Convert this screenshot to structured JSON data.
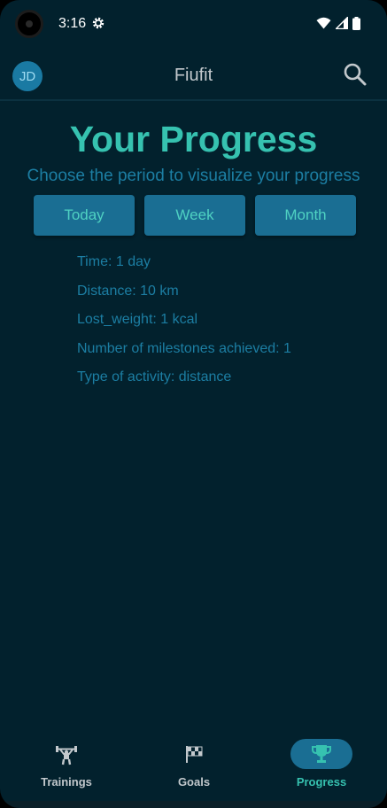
{
  "status_bar": {
    "time": "3:16"
  },
  "app_bar": {
    "avatar_initials": "JD",
    "title": "Fiufit"
  },
  "main": {
    "heading": "Your Progress",
    "subheading": "Choose the period to visualize your progress",
    "period_buttons": [
      "Today",
      "Week",
      "Month"
    ],
    "stats": [
      "Time: 1 day",
      "Distance: 10 km",
      "Lost_weight: 1 kcal",
      "Number of milestones achieved: 1",
      "Type of activity: distance"
    ]
  },
  "bottom_nav": {
    "items": [
      {
        "label": "Trainings",
        "icon": "weightlifter-icon"
      },
      {
        "label": "Goals",
        "icon": "checkered-flag-icon"
      },
      {
        "label": "Progress",
        "icon": "trophy-icon",
        "active": true
      }
    ]
  },
  "colors": {
    "background": "#02212d",
    "accent": "#36c2b0",
    "button": "#1a6e93",
    "secondary_text": "#1c7ea3"
  }
}
